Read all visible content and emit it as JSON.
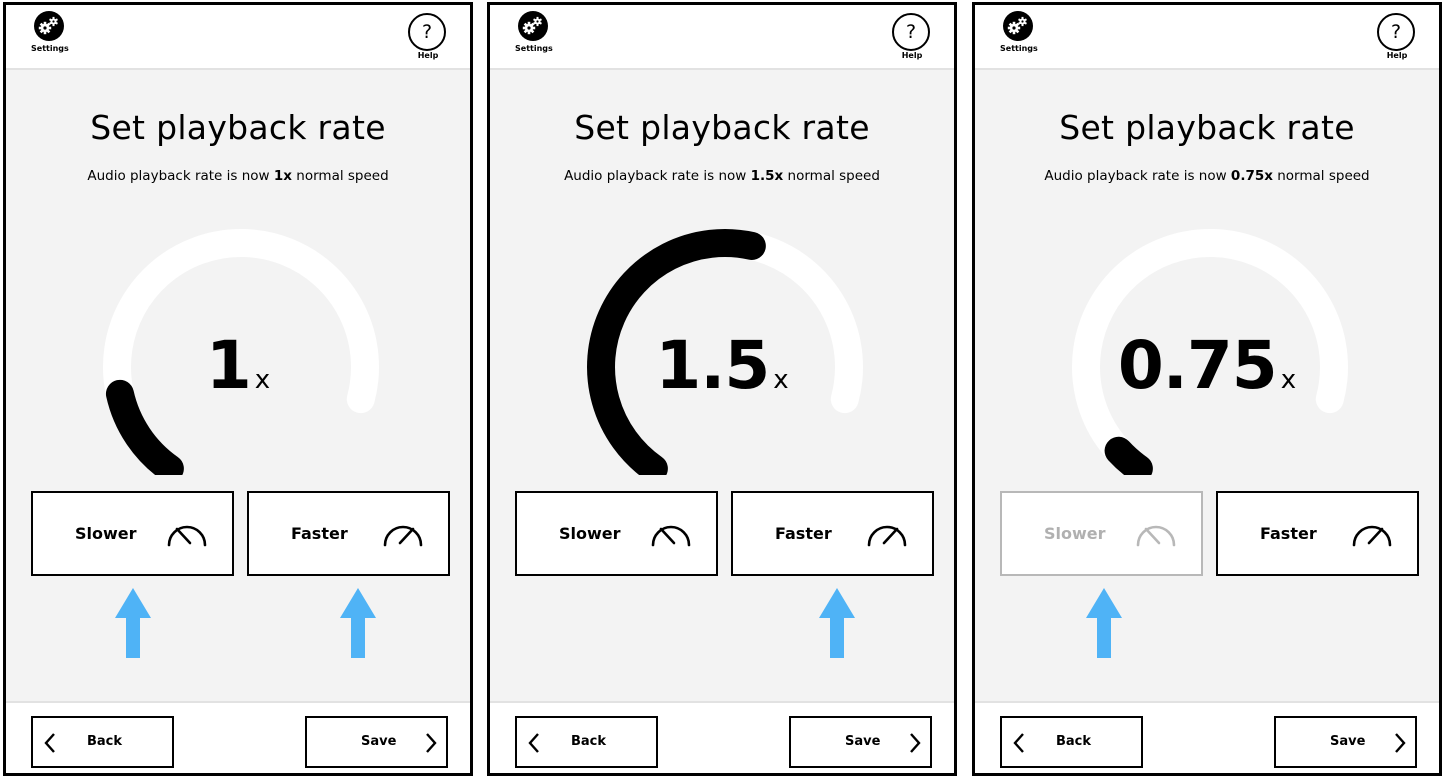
{
  "app": {
    "settings_label": "Settings",
    "help_symbol": "?",
    "help_label": "Help",
    "settings_icon": "gears-icon"
  },
  "screens": [
    {
      "title": "Set playback rate",
      "subtitle_prefix": "Audio playback rate is now ",
      "subtitle_value": "1x",
      "subtitle_suffix": " normal speed",
      "rate_value": "1",
      "rate_unit": "x",
      "gauge_level": 0.17,
      "slower": {
        "label": "Slower",
        "enabled": true,
        "icon": "speedometer-slow-icon"
      },
      "faster": {
        "label": "Faster",
        "enabled": true,
        "icon": "speedometer-fast-icon"
      },
      "arrows": [
        "slower",
        "faster"
      ],
      "back_label": "Back",
      "save_label": "Save"
    },
    {
      "title": "Set playback rate",
      "subtitle_prefix": "Audio playback rate is now ",
      "subtitle_value": "1.5x",
      "subtitle_suffix": " normal speed",
      "rate_value": "1.5",
      "rate_unit": "x",
      "gauge_level": 0.63,
      "slower": {
        "label": "Slower",
        "enabled": true,
        "icon": "speedometer-slow-icon"
      },
      "faster": {
        "label": "Faster",
        "enabled": true,
        "icon": "speedometer-fast-icon"
      },
      "arrows": [
        "faster"
      ],
      "back_label": "Back",
      "save_label": "Save"
    },
    {
      "title": "Set playback rate",
      "subtitle_prefix": "Audio playback rate is now ",
      "subtitle_value": "0.75x",
      "subtitle_suffix": " normal speed",
      "rate_value": "0.75",
      "rate_unit": "x",
      "gauge_level": 0.05,
      "slower": {
        "label": "Slower",
        "enabled": false,
        "icon": "speedometer-slow-icon"
      },
      "faster": {
        "label": "Faster",
        "enabled": true,
        "icon": "speedometer-fast-icon"
      },
      "arrows": [
        "slower"
      ],
      "back_label": "Back",
      "save_label": "Save"
    }
  ],
  "colors": {
    "accent_arrow": "#4fb3f6",
    "gauge_track": "#ffffff",
    "gauge_fill": "#000000",
    "background": "#f3f3f3",
    "disabled": "#b8b8b8"
  }
}
